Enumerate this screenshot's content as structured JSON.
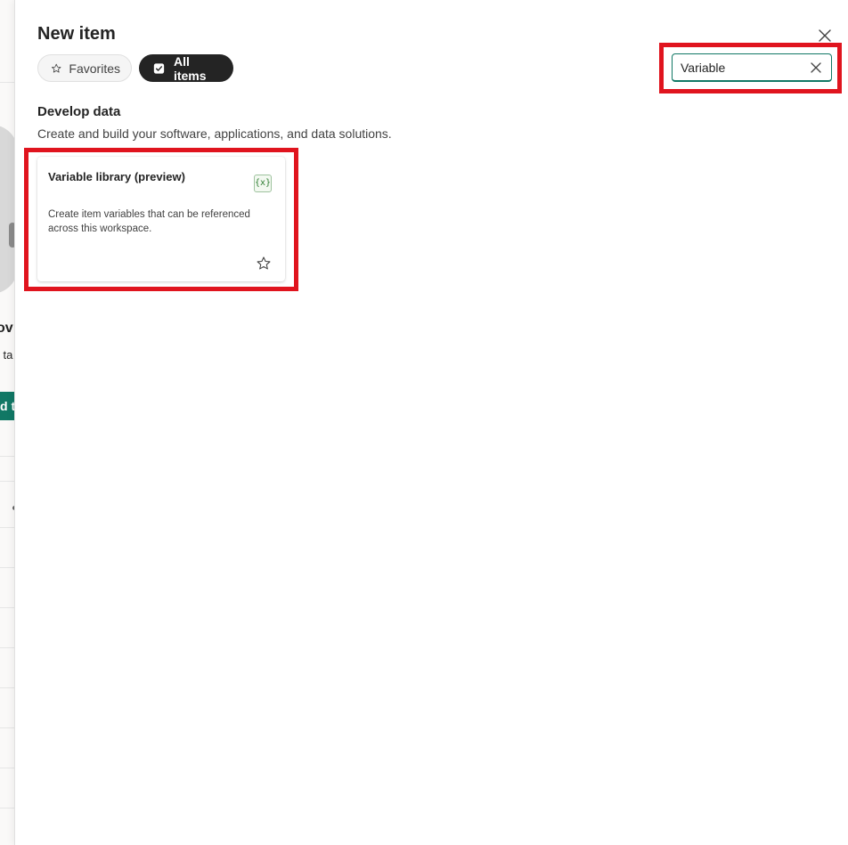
{
  "background": {
    "partial_texts": [
      "ov",
      "l ta",
      "d t"
    ]
  },
  "panel": {
    "title": "New item",
    "filters": {
      "favorites_label": "Favorites",
      "all_items_label": "All items",
      "active": "All items"
    },
    "search": {
      "value": "Variable",
      "placeholder": ""
    },
    "section": {
      "title": "Develop data",
      "description": "Create and build your software, applications, and data solutions."
    },
    "cards": [
      {
        "title": "Variable library (preview)",
        "icon": "{x}",
        "description": "Create item variables that can be referenced across this workspace."
      }
    ]
  },
  "colors": {
    "accent": "#117865",
    "highlight": "#e0141e",
    "active_pill": "#242424"
  }
}
